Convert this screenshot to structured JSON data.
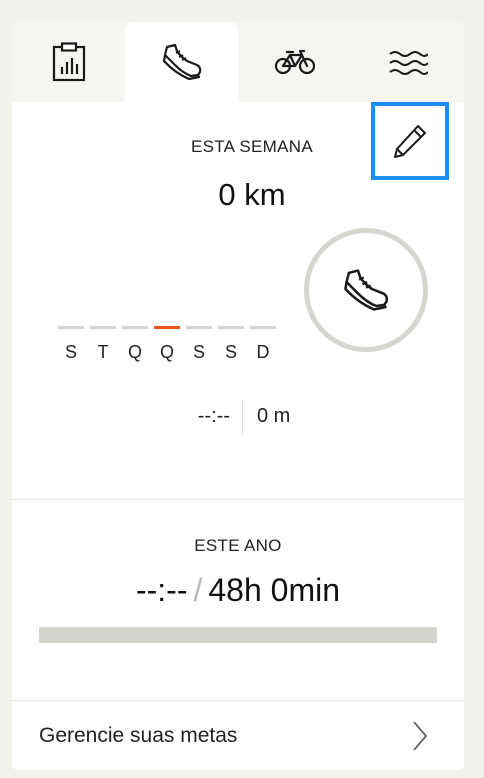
{
  "tabs": [
    {
      "name": "summary",
      "icon": "clipboard-chart-icon",
      "active": false
    },
    {
      "name": "run",
      "icon": "running-shoe-icon",
      "active": true
    },
    {
      "name": "ride",
      "icon": "bicycle-icon",
      "active": false
    },
    {
      "name": "swim",
      "icon": "waves-icon",
      "active": false
    }
  ],
  "week": {
    "label": "ESTA SEMANA",
    "distance": "0 km",
    "days": [
      "S",
      "T",
      "Q",
      "Q",
      "S",
      "S",
      "D"
    ],
    "today_index": 3,
    "time": "--:--",
    "elevation": "0 m",
    "ring_icon": "running-shoe-icon"
  },
  "year": {
    "label": "ESTE ANO",
    "current": "--:--",
    "separator": "/",
    "goal": "48h 0min",
    "progress_fraction": 0
  },
  "manage": {
    "label": "Gerencie suas metas"
  },
  "colors": {
    "accent": "#e8541a",
    "highlight_border": "#1d8cf0",
    "track": "#d3d2cd"
  }
}
